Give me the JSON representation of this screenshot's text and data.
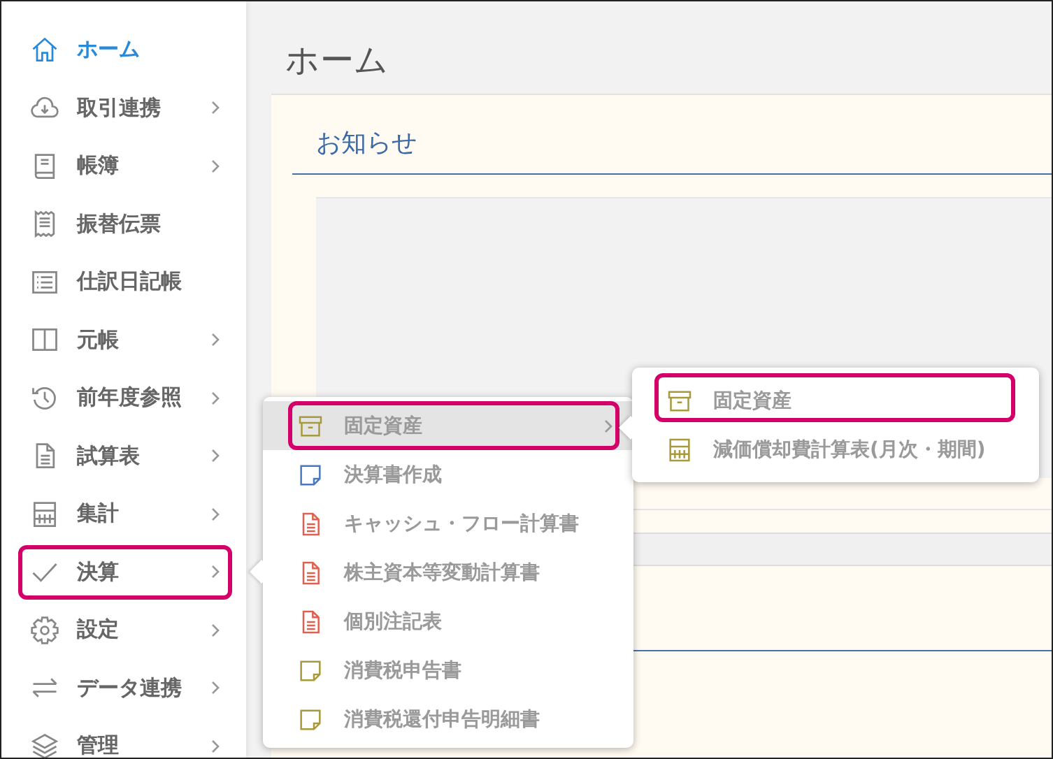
{
  "sidebar": {
    "items": [
      {
        "label": "ホーム",
        "kind": "home",
        "submenu": false,
        "selected": true,
        "highlighted": false
      },
      {
        "label": "取引連携",
        "kind": "cloud",
        "submenu": true,
        "selected": false,
        "highlighted": false
      },
      {
        "label": "帳簿",
        "kind": "book",
        "submenu": true,
        "selected": false,
        "highlighted": false
      },
      {
        "label": "振替伝票",
        "kind": "receipt",
        "submenu": false,
        "selected": false,
        "highlighted": false
      },
      {
        "label": "仕訳日記帳",
        "kind": "list",
        "submenu": false,
        "selected": false,
        "highlighted": false
      },
      {
        "label": "元帳",
        "kind": "columns",
        "submenu": true,
        "selected": false,
        "highlighted": false
      },
      {
        "label": "前年度参照",
        "kind": "history",
        "submenu": true,
        "selected": false,
        "highlighted": false
      },
      {
        "label": "試算表",
        "kind": "document",
        "submenu": true,
        "selected": false,
        "highlighted": false
      },
      {
        "label": "集計",
        "kind": "calculator",
        "submenu": true,
        "selected": false,
        "highlighted": false
      },
      {
        "label": "決算",
        "kind": "check",
        "submenu": true,
        "selected": false,
        "highlighted": true
      },
      {
        "label": "設定",
        "kind": "gear",
        "submenu": true,
        "selected": false,
        "highlighted": false
      },
      {
        "label": "データ連携",
        "kind": "arrows",
        "submenu": true,
        "selected": false,
        "highlighted": false
      },
      {
        "label": "管理",
        "kind": "layers",
        "submenu": true,
        "selected": false,
        "highlighted": false
      }
    ]
  },
  "page": {
    "title": "ホーム",
    "notice": {
      "heading": "お知らせ"
    }
  },
  "menu": {
    "items": [
      {
        "label": "固定資産",
        "kind": "archive",
        "color": "#a89a3c",
        "submenu": true,
        "selected": true,
        "highlighted": true
      },
      {
        "label": "決算書作成",
        "kind": "note",
        "color": "#4a78c0",
        "submenu": false,
        "selected": false,
        "highlighted": false
      },
      {
        "label": "キャッシュ・フロー計算書",
        "kind": "document",
        "color": "#e06050",
        "submenu": false,
        "selected": false,
        "highlighted": false
      },
      {
        "label": "株主資本等変動計算書",
        "kind": "document",
        "color": "#e06050",
        "submenu": false,
        "selected": false,
        "highlighted": false
      },
      {
        "label": "個別注記表",
        "kind": "document",
        "color": "#e06050",
        "submenu": false,
        "selected": false,
        "highlighted": false
      },
      {
        "label": "消費税申告書",
        "kind": "note",
        "color": "#a89a3c",
        "submenu": false,
        "selected": false,
        "highlighted": false
      },
      {
        "label": "消費税還付申告明細書",
        "kind": "note",
        "color": "#a89a3c",
        "submenu": false,
        "selected": false,
        "highlighted": false
      }
    ]
  },
  "submenu": {
    "items": [
      {
        "label": "固定資産",
        "kind": "archive",
        "color": "#a89a3c",
        "highlighted": true
      },
      {
        "label": "減価償却費計算表(月次・期間)",
        "kind": "calculator",
        "color": "#a89a3c",
        "highlighted": false
      }
    ]
  }
}
